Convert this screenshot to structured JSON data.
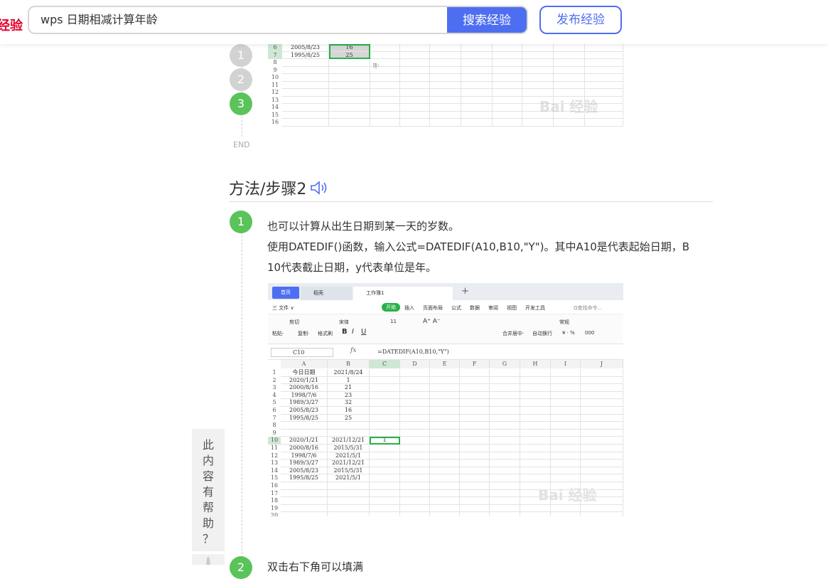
{
  "header": {
    "brand_fragment": "经验",
    "search_value": "wps 日期相减计算年龄",
    "search_button": "搜索经验",
    "publish_button": "发布经验"
  },
  "timeline1": {
    "steps": [
      "1",
      "2",
      "3"
    ],
    "end_label": "END"
  },
  "top_sheet": {
    "rows": [
      {
        "num": "6",
        "a": "2005/8/23",
        "b": "16"
      },
      {
        "num": "7",
        "a": "1995/8/25",
        "b": "25"
      },
      {
        "num": "8",
        "a": "",
        "b": ""
      },
      {
        "num": "9",
        "a": "",
        "b": ""
      },
      {
        "num": "10",
        "a": "",
        "b": ""
      },
      {
        "num": "11",
        "a": "",
        "b": ""
      },
      {
        "num": "12",
        "a": "",
        "b": ""
      },
      {
        "num": "13",
        "a": "",
        "b": ""
      },
      {
        "num": "14",
        "a": "",
        "b": ""
      },
      {
        "num": "15",
        "a": "",
        "b": ""
      },
      {
        "num": "16",
        "a": "",
        "b": ""
      }
    ],
    "paste_icon_label": "⎘·",
    "watermark": "Bai 经验"
  },
  "section": {
    "title": "方法/步骤2"
  },
  "step1": {
    "num": "1",
    "line1": "也可以计算从出生日期到某一天的岁数。",
    "line2": "使用DATEDIF()函数，输入公式=DATEDIF(A10,B10,\"Y\")。其中A10是代表起始日期，B",
    "line3": "10代表截止日期，y代表单位是年。"
  },
  "sheet2": {
    "tabs": {
      "home": "首页",
      "daoke": "稻壳",
      "workbook": "工作簿1"
    },
    "menu": [
      "三 文件 ∨",
      "开始",
      "插入",
      "页面布局",
      "公式",
      "数据",
      "审阅",
      "视图",
      "开发工具",
      "Q查找命令..."
    ],
    "ribbon": [
      "剪切",
      "宋体",
      "11",
      "A⁺ A⁻",
      "常规",
      "粘贴·",
      "复制·",
      "格式刷",
      "B",
      "I",
      "U",
      "合并居中·",
      "自动换行",
      "¥ · %",
      "000"
    ],
    "name_box": "C10",
    "formula": "=DATEDIF(A10,B10,\"Y\")",
    "columns": [
      "A",
      "B",
      "C",
      "D",
      "E",
      "F",
      "G",
      "H",
      "I",
      "J"
    ],
    "rows": [
      {
        "num": "1",
        "a": "今日日期",
        "b": "2021/8/24",
        "c": ""
      },
      {
        "num": "2",
        "a": "2020/1/21",
        "b": "1",
        "c": ""
      },
      {
        "num": "3",
        "a": "2000/8/16",
        "b": "21",
        "c": ""
      },
      {
        "num": "4",
        "a": "1998/7/6",
        "b": "23",
        "c": ""
      },
      {
        "num": "5",
        "a": "1989/3/27",
        "b": "32",
        "c": ""
      },
      {
        "num": "6",
        "a": "2005/8/23",
        "b": "16",
        "c": ""
      },
      {
        "num": "7",
        "a": "1995/8/25",
        "b": "25",
        "c": ""
      },
      {
        "num": "8",
        "a": "",
        "b": "",
        "c": ""
      },
      {
        "num": "9",
        "a": "",
        "b": "",
        "c": ""
      },
      {
        "num": "10",
        "a": "2020/1/21",
        "b": "2021/12/21",
        "c": "1"
      },
      {
        "num": "11",
        "a": "2000/8/16",
        "b": "2015/5/31",
        "c": ""
      },
      {
        "num": "12",
        "a": "1998/7/6",
        "b": "2021/5/1",
        "c": ""
      },
      {
        "num": "13",
        "a": "1989/3/27",
        "b": "2021/12/21",
        "c": ""
      },
      {
        "num": "14",
        "a": "2005/8/23",
        "b": "2015/5/31",
        "c": ""
      },
      {
        "num": "15",
        "a": "1995/8/25",
        "b": "2021/5/1",
        "c": ""
      },
      {
        "num": "16",
        "a": "",
        "b": "",
        "c": ""
      },
      {
        "num": "17",
        "a": "",
        "b": "",
        "c": ""
      },
      {
        "num": "18",
        "a": "",
        "b": "",
        "c": ""
      },
      {
        "num": "19",
        "a": "",
        "b": "",
        "c": ""
      },
      {
        "num": "20",
        "a": "",
        "b": "",
        "c": ""
      }
    ],
    "watermark": "Bai 经验"
  },
  "helpful": {
    "text": "此内容有帮助？"
  },
  "step2": {
    "num": "2",
    "text": "双击右下角可以填满"
  },
  "colors": {
    "accent": "#4e6ef2",
    "green": "#5ac35a",
    "grey_dot": "#d2d2d2",
    "brand_red": "#e4002b"
  }
}
